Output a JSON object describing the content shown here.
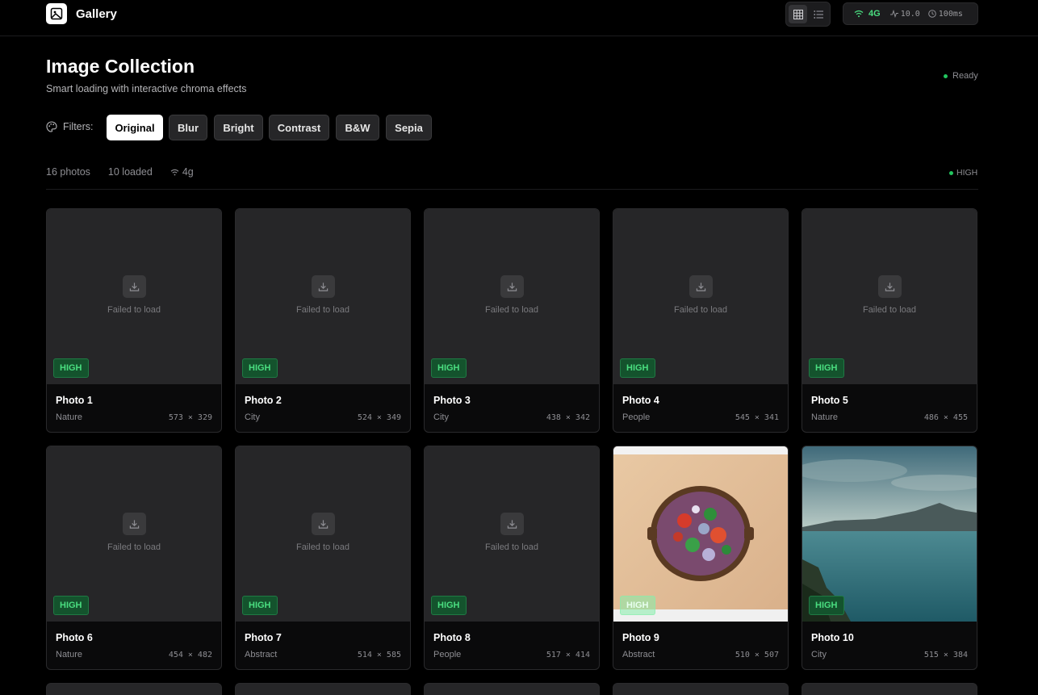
{
  "app": {
    "title": "Gallery"
  },
  "network": {
    "type": "4G",
    "speed": "10.0",
    "latency": "100ms"
  },
  "header": {
    "title": "Image Collection",
    "subtitle": "Smart loading with interactive chroma effects",
    "status": "Ready"
  },
  "filters": {
    "label": "Filters:",
    "options": [
      "Original",
      "Blur",
      "Bright",
      "Contrast",
      "B&W",
      "Sepia"
    ],
    "selected": "Original"
  },
  "stats": {
    "photos": "16 photos",
    "loaded": "10 loaded",
    "connection": "4g",
    "quality": "HIGH"
  },
  "fail_text": "Failed to load",
  "photos": [
    {
      "title": "Photo 1",
      "category": "Nature",
      "dims": "573 × 329",
      "badge": "HIGH",
      "state": "failed"
    },
    {
      "title": "Photo 2",
      "category": "City",
      "dims": "524 × 349",
      "badge": "HIGH",
      "state": "failed"
    },
    {
      "title": "Photo 3",
      "category": "City",
      "dims": "438 × 342",
      "badge": "HIGH",
      "state": "failed"
    },
    {
      "title": "Photo 4",
      "category": "People",
      "dims": "545 × 341",
      "badge": "HIGH",
      "state": "failed"
    },
    {
      "title": "Photo 5",
      "category": "Nature",
      "dims": "486 × 455",
      "badge": "HIGH",
      "state": "failed"
    },
    {
      "title": "Photo 6",
      "category": "Nature",
      "dims": "454 × 482",
      "badge": "HIGH",
      "state": "failed"
    },
    {
      "title": "Photo 7",
      "category": "Abstract",
      "dims": "514 × 585",
      "badge": "HIGH",
      "state": "failed"
    },
    {
      "title": "Photo 8",
      "category": "People",
      "dims": "517 × 414",
      "badge": "HIGH",
      "state": "failed"
    },
    {
      "title": "Photo 9",
      "category": "Abstract",
      "dims": "510 × 507",
      "badge": "HIGH",
      "state": "loaded-bowl"
    },
    {
      "title": "Photo 10",
      "category": "City",
      "dims": "515 × 384",
      "badge": "HIGH",
      "state": "loaded-lake"
    }
  ]
}
